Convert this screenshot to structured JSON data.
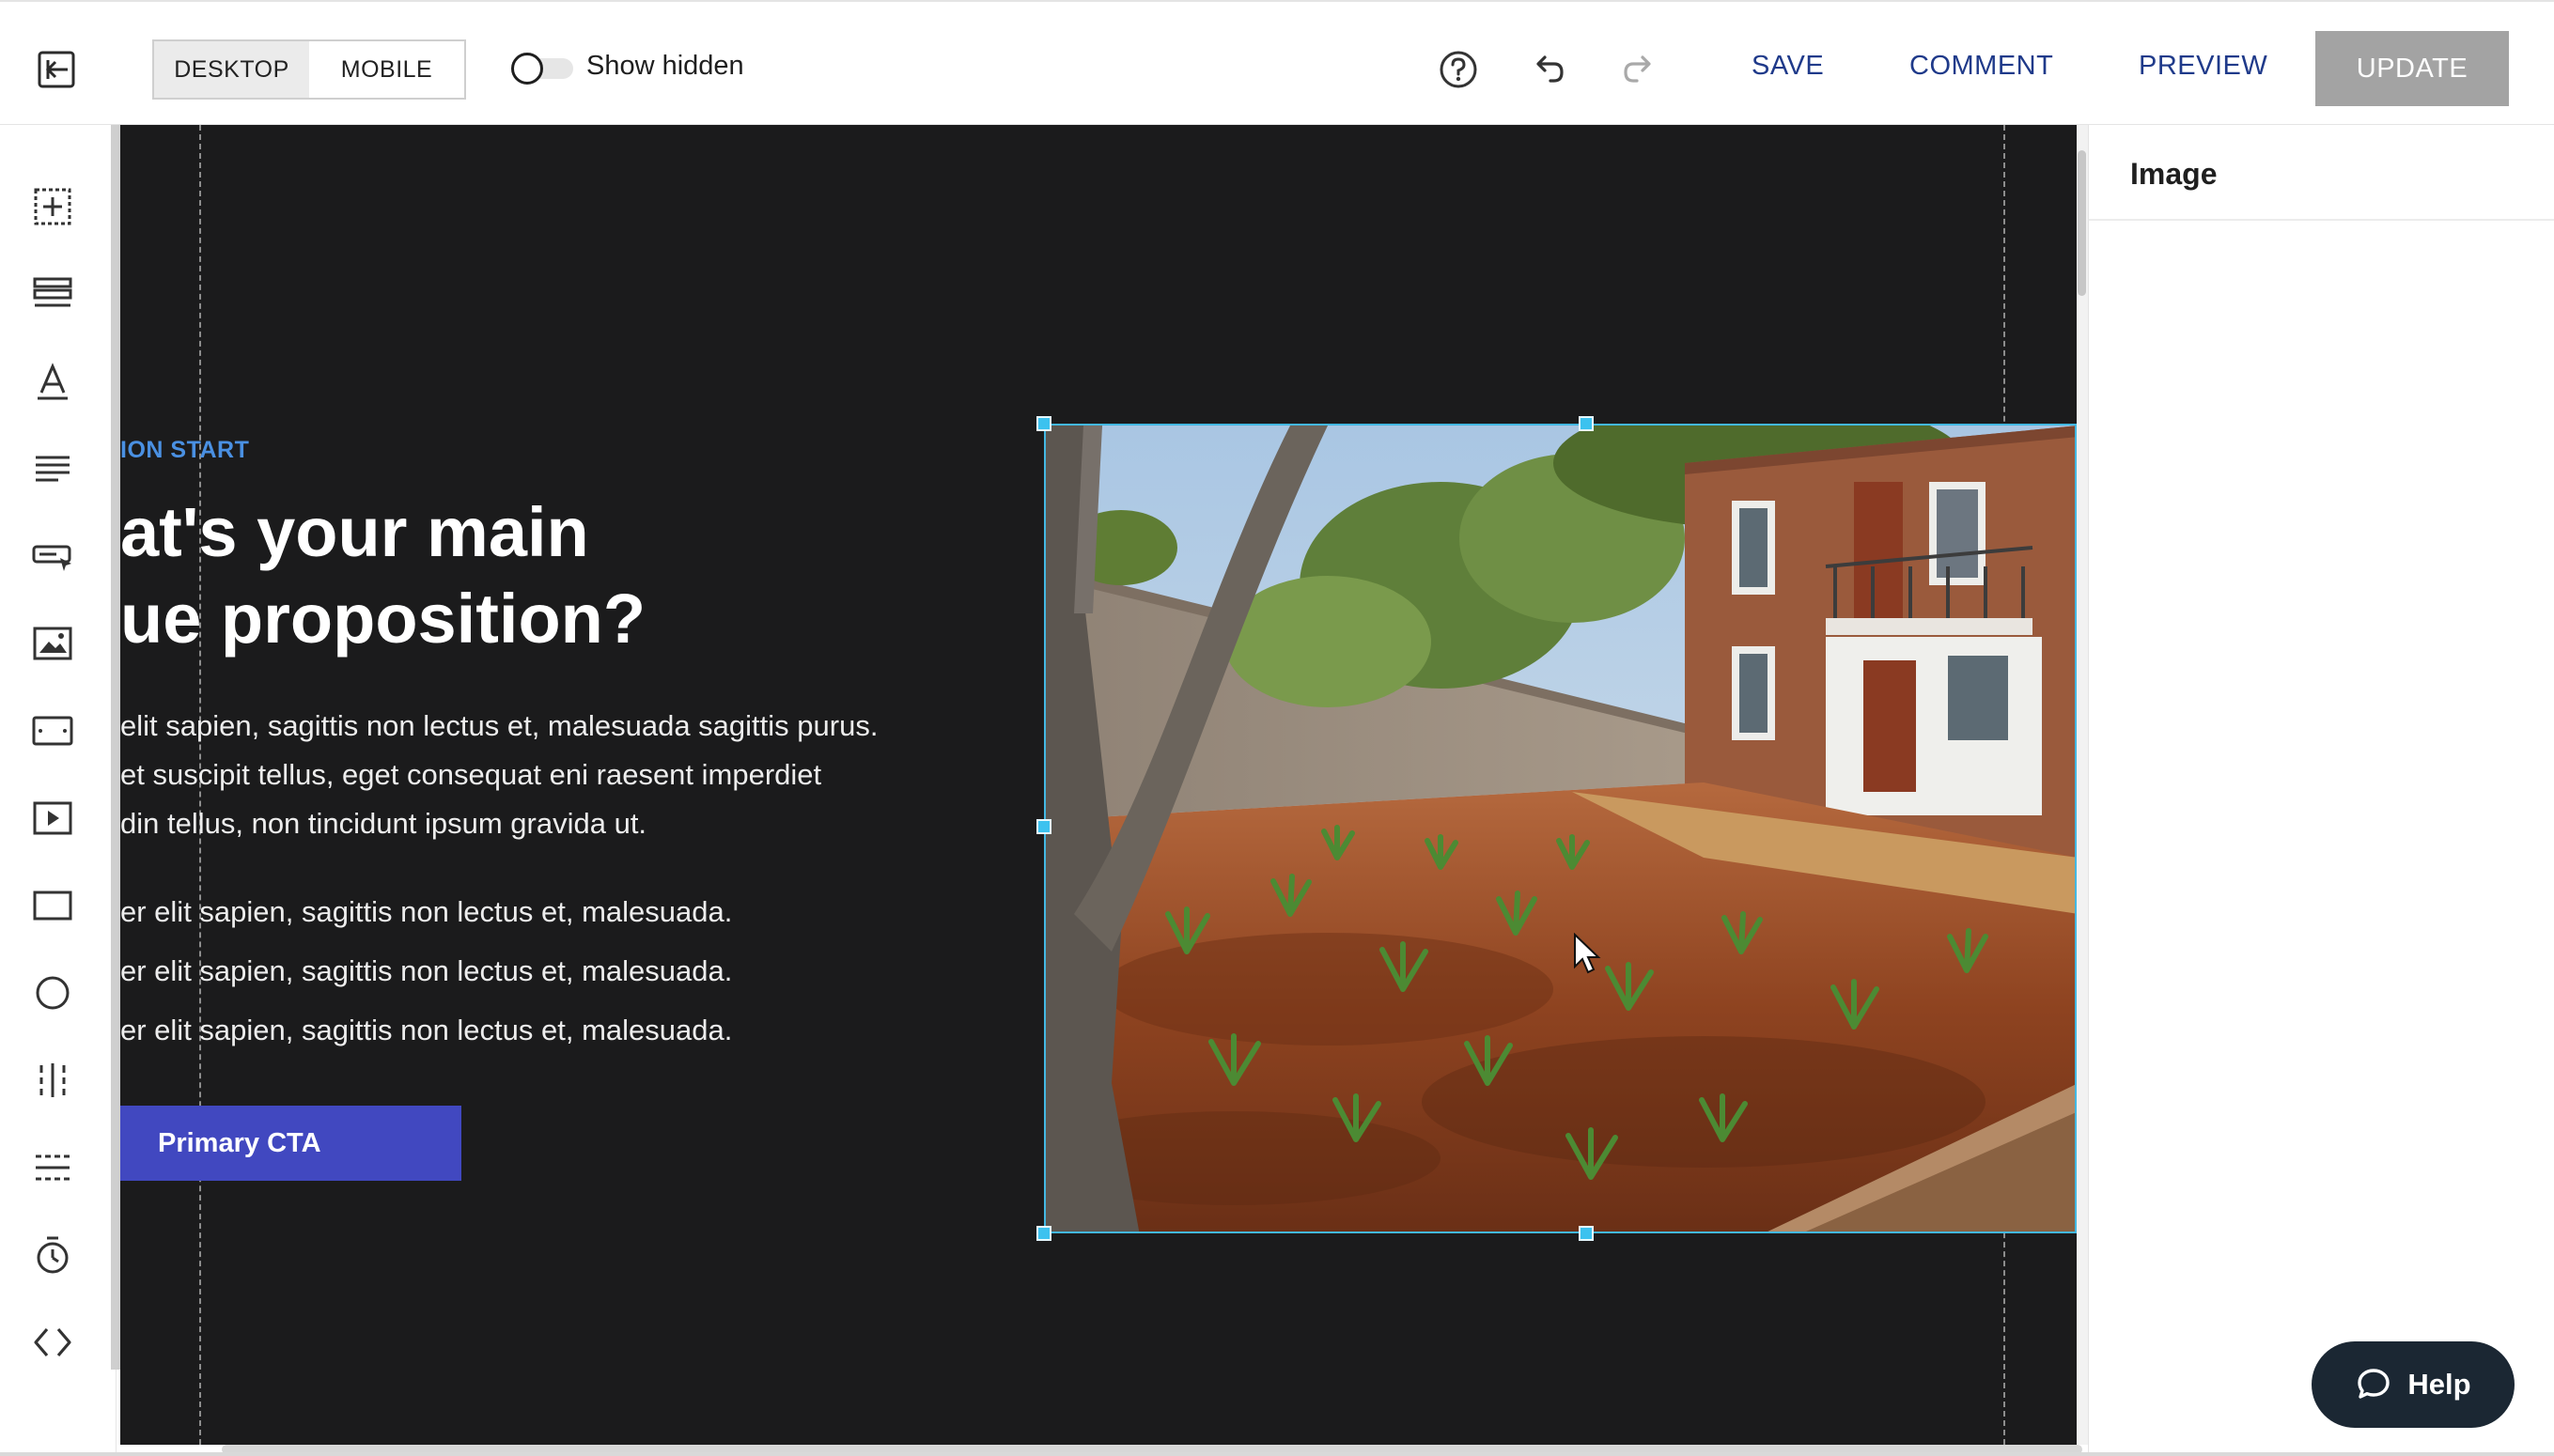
{
  "toolbar": {
    "exit_icon": "exit-editor-icon",
    "device_modes": [
      "DESKTOP",
      "MOBILE"
    ],
    "active_device": "DESKTOP",
    "show_hidden_label": "Show hidden",
    "show_hidden_on": false,
    "help_icon": "question-circle-icon",
    "undo_icon": "undo-icon",
    "redo_icon": "redo-icon",
    "save_label": "SAVE",
    "comment_label": "COMMENT",
    "preview_label": "PREVIEW",
    "update_label": "UPDATE"
  },
  "sidebar": {
    "tools": [
      {
        "name": "add-section-icon"
      },
      {
        "name": "rows-icon"
      },
      {
        "name": "heading-icon"
      },
      {
        "name": "paragraph-icon"
      },
      {
        "name": "button-icon"
      },
      {
        "name": "image-icon"
      },
      {
        "name": "spacer-icon"
      },
      {
        "name": "video-icon"
      },
      {
        "name": "box-icon"
      },
      {
        "name": "circle-icon"
      },
      {
        "name": "column-divider-icon"
      },
      {
        "name": "divider-icon"
      },
      {
        "name": "timer-icon"
      },
      {
        "name": "code-icon"
      }
    ]
  },
  "canvas": {
    "eyebrow": "ION START",
    "headline_line1": "at's your main",
    "headline_line2": "ue proposition?",
    "body_line1": "elit sapien, sagittis non lectus et, malesuada sagittis purus.",
    "body_line2": "et suscipit tellus, eget consequat eni raesent imperdiet",
    "body_line3": "din tellus, non tincidunt ipsum gravida ut.",
    "bullets": [
      "er elit sapien, sagittis non lectus et, malesuada.",
      "er elit sapien, sagittis non lectus et, malesuada.",
      "er elit sapien, sagittis non lectus et, malesuada."
    ],
    "cta_label": "Primary CTA",
    "selected_image": "garden-photo"
  },
  "panel": {
    "title": "Image"
  },
  "help": {
    "label": "Help",
    "icon": "chat-bubble-icon"
  },
  "colors": {
    "accent": "#1f3a8a",
    "canvas_bg": "#1b1b1c",
    "cta": "#4148c0",
    "eyebrow": "#4a90e2",
    "selection": "#43b8e2",
    "update_disabled": "#a3a3a3",
    "help_bg": "#1b2733"
  }
}
